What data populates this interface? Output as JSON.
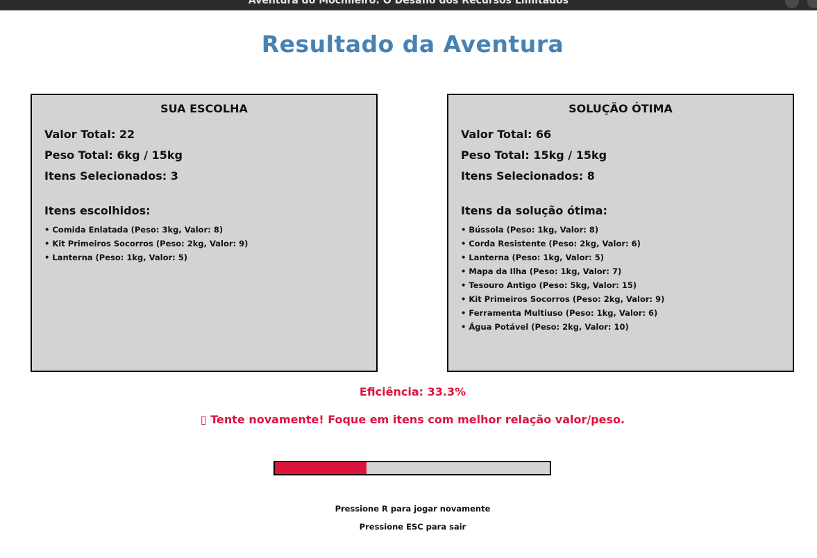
{
  "window": {
    "title": "Aventura do Mochileiro: O Desafio dos Recursos Limitados"
  },
  "heading": "Resultado da Aventura",
  "player": {
    "title": "SUA ESCOLHA",
    "total_value": "Valor Total: 22",
    "total_weight": "Peso Total: 6kg / 15kg",
    "selected_count": "Itens Selecionados: 3",
    "items_title": "Itens escolhidos:",
    "items": [
      "• Comida Enlatada (Peso: 3kg, Valor: 8)",
      "• Kit Primeiros Socorros (Peso: 2kg, Valor: 9)",
      "• Lanterna (Peso: 1kg, Valor: 5)"
    ]
  },
  "optimal": {
    "title": "SOLUÇÃO ÓTIMA",
    "total_value": "Valor Total: 66",
    "total_weight": "Peso Total: 15kg / 15kg",
    "selected_count": "Itens Selecionados: 8",
    "items_title": "Itens da solução ótima:",
    "items": [
      "• Bússola (Peso: 1kg, Valor: 8)",
      "• Corda Resistente (Peso: 2kg, Valor: 6)",
      "• Lanterna (Peso: 1kg, Valor: 5)",
      "• Mapa da Ilha (Peso: 1kg, Valor: 7)",
      "• Tesouro Antigo (Peso: 5kg, Valor: 15)",
      "• Kit Primeiros Socorros (Peso: 2kg, Valor: 9)",
      "• Ferramenta Multiuso (Peso: 1kg, Valor: 6)",
      "• Água Potável (Peso: 2kg, Valor: 10)"
    ]
  },
  "efficiency": {
    "label": "Eficiência: 33.3%",
    "fraction": 0.333
  },
  "message": "▯ Tente novamente! Foque em itens com melhor relação valor/peso.",
  "instructions": {
    "replay": "Pressione R para jogar novamente",
    "exit": "Pressione ESC para sair"
  },
  "colors": {
    "heading": "#4682b4",
    "panel_bg": "#d3d3d3",
    "alert": "#dc143c",
    "bar_fill": "#dc143c"
  }
}
